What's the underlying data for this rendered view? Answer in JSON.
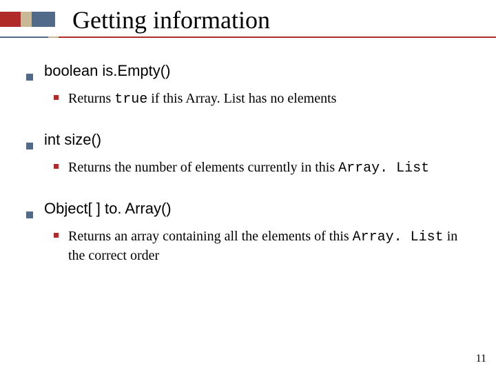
{
  "title": "Getting information",
  "items": [
    {
      "header": "boolean is.Empty()",
      "sub_pre": "Returns ",
      "sub_code": "true",
      "sub_post": " if this Array. List has no elements"
    },
    {
      "header": "int size()",
      "sub_pre": "Returns the number of elements currently in this ",
      "sub_code": "Array. List",
      "sub_post": ""
    },
    {
      "header": "Object[ ] to. Array()",
      "sub_pre": "Returns an array containing all the elements of this ",
      "sub_code": "Array. List",
      "sub_post": " in the correct order"
    }
  ],
  "page_number": "11"
}
